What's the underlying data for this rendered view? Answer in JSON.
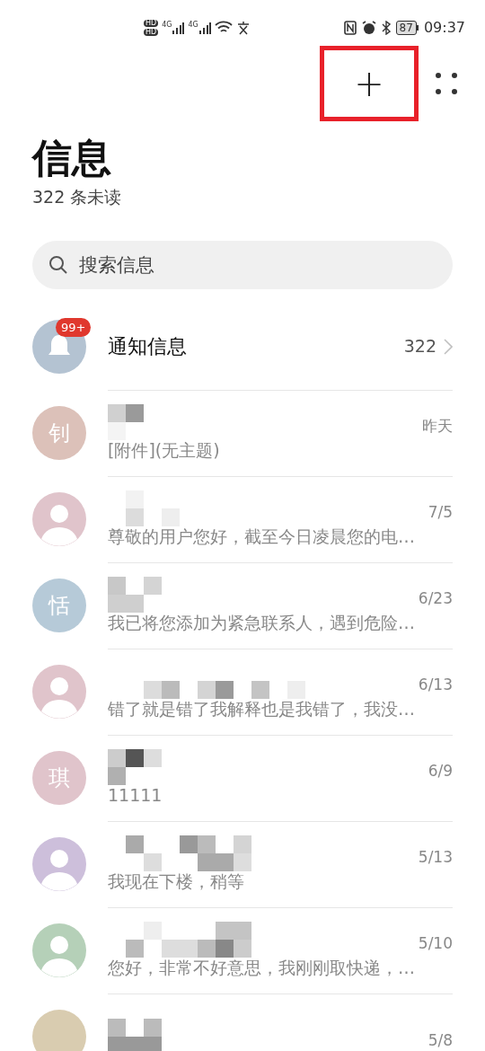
{
  "status_bar": {
    "sim_labels": [
      "HD",
      "HD"
    ],
    "network": [
      "4G",
      "4G"
    ],
    "battery": "87",
    "time": "09:37"
  },
  "toolbar": {
    "add_button": {
      "label": "+",
      "highlighted": true
    }
  },
  "title": "信息",
  "unread": "322 条未读",
  "search": {
    "placeholder": "搜索信息"
  },
  "conversations": [
    {
      "kind": "bell",
      "color": "#b4c3d2",
      "badge": "99+",
      "name": "通知信息",
      "count": "322"
    },
    {
      "kind": "letter",
      "letter": "钊",
      "color": "#dcc1b9",
      "date": "昨天",
      "preview": "[附件](无主题)"
    },
    {
      "kind": "person",
      "color": "#e0c4cb",
      "date": "7/5",
      "preview": "尊敬的用户您好，截至今日凌晨您的电…"
    },
    {
      "kind": "letter",
      "letter": "恬",
      "color": "#b6cad8",
      "date": "6/23",
      "preview": "我已将您添加为紧急联系人，遇到危险…"
    },
    {
      "kind": "person",
      "color": "#e0c4cb",
      "date": "6/13",
      "preview": "错了就是错了我解释也是我错了，我没…"
    },
    {
      "kind": "letter",
      "letter": "琪",
      "color": "#e0c4cb",
      "date": "6/9",
      "preview": "11111"
    },
    {
      "kind": "person",
      "color": "#cdbfdb",
      "date": "5/13",
      "preview": "我现在下楼，稍等"
    },
    {
      "kind": "person",
      "color": "#b5d0b8",
      "date": "5/10",
      "preview": "您好，非常不好意思，我刚刚取快递，…"
    },
    {
      "kind": "blank",
      "color": "#d9ccb0",
      "date": "5/8"
    }
  ]
}
